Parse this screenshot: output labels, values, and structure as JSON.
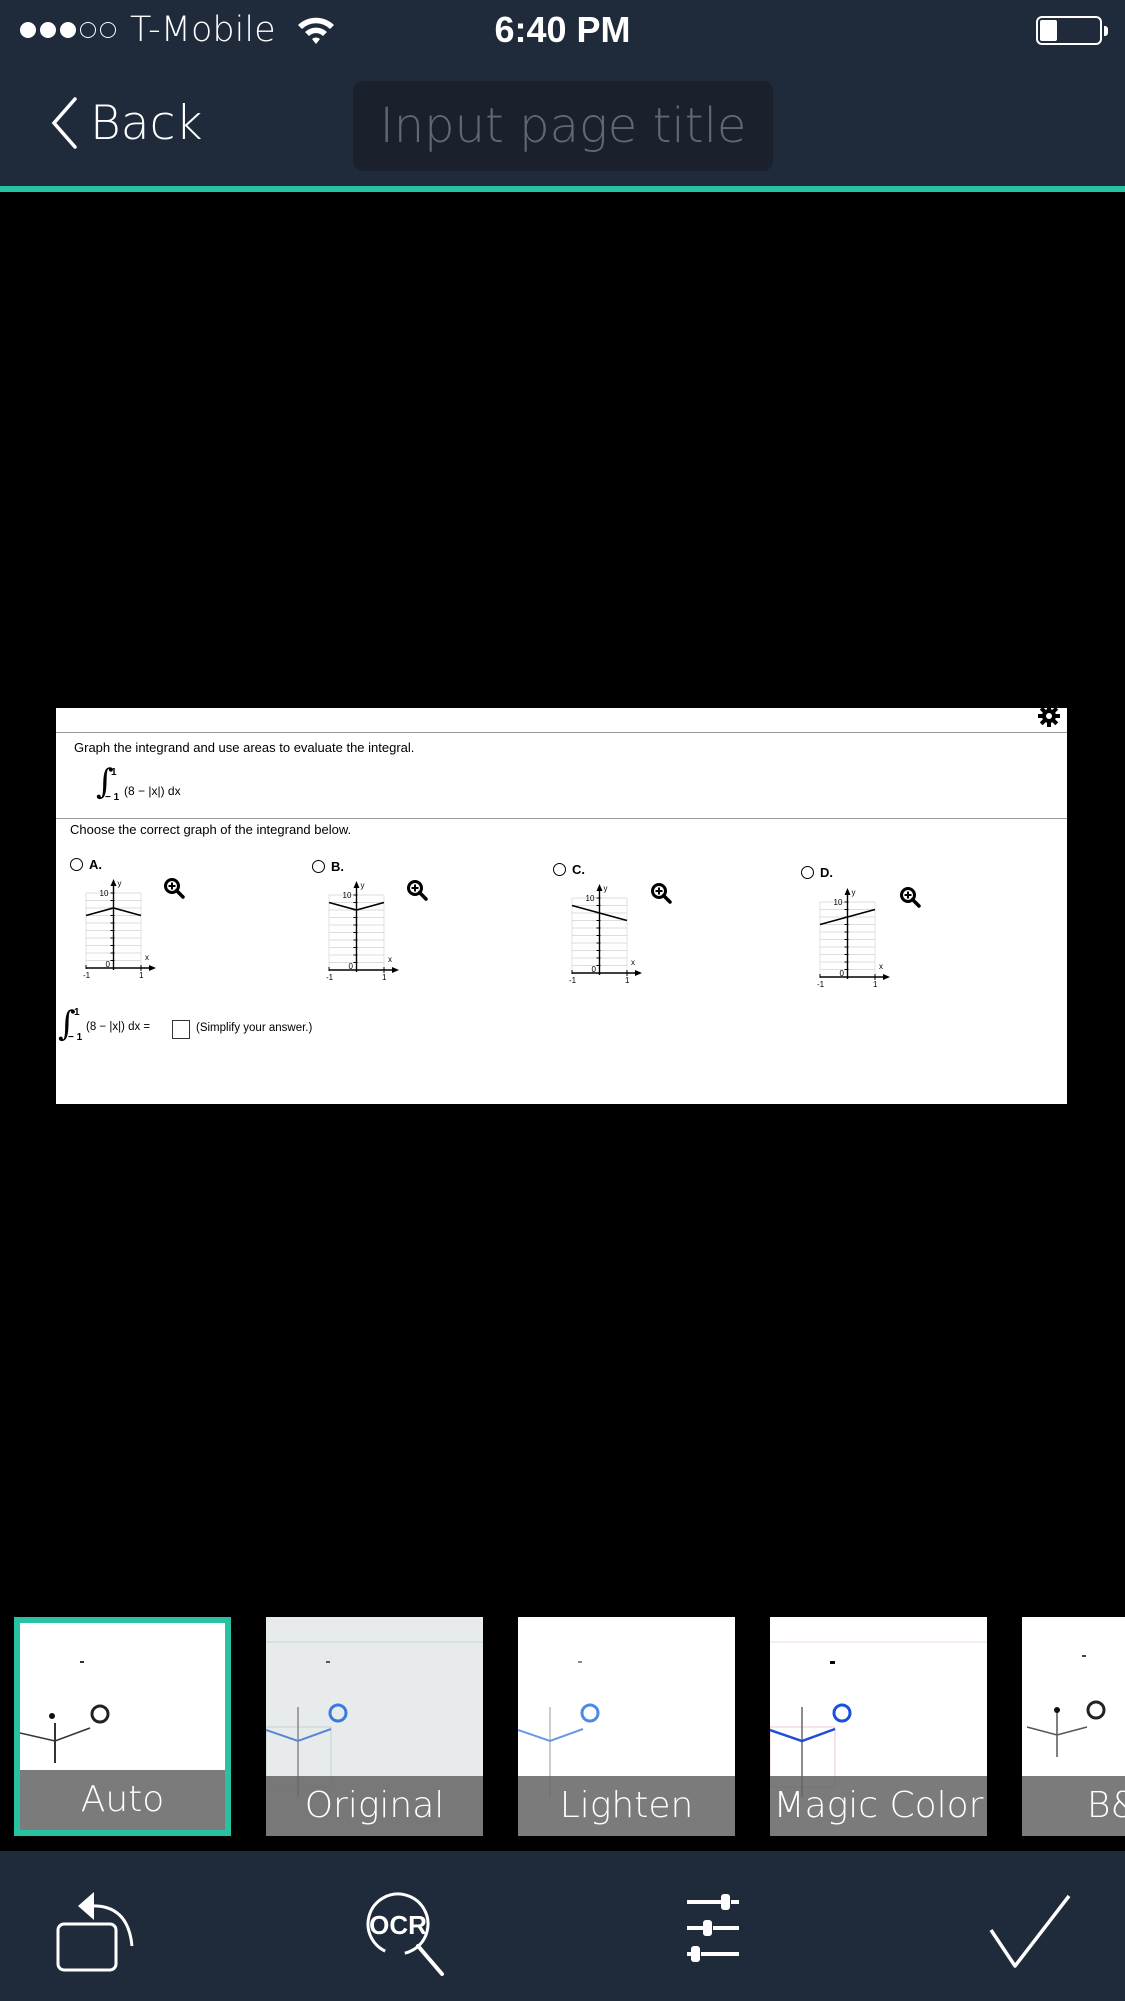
{
  "status_bar": {
    "signal_bars_filled": 3,
    "signal_bars_total": 5,
    "carrier": "T-Mobile",
    "time": "6:40 PM",
    "battery_level": 0.3
  },
  "nav": {
    "back_label": "Back",
    "title_placeholder": "Input page title",
    "title_value": ""
  },
  "colors": {
    "bar_background": "#1f2a3b",
    "accent": "#26c2a2",
    "title_field": "#1a212c",
    "placeholder": "#5e6877"
  },
  "document": {
    "instruction": "Graph the integrand and use areas to evaluate the integral.",
    "integral": {
      "upper": "1",
      "lower": "− 1",
      "integrand": "(8 − |x|) dx"
    },
    "prompt": "Choose the correct graph of the integrand below.",
    "options": [
      {
        "label": "A.",
        "points": [
          [
            -1,
            7
          ],
          [
            0,
            8
          ],
          [
            1,
            7
          ]
        ]
      },
      {
        "label": "B.",
        "points": [
          [
            -1,
            9
          ],
          [
            0,
            8
          ],
          [
            1,
            9
          ]
        ]
      },
      {
        "label": "C.",
        "points": [
          [
            -1,
            9
          ],
          [
            1,
            7
          ]
        ]
      },
      {
        "label": "D.",
        "points": [
          [
            -1,
            7
          ],
          [
            1,
            9
          ]
        ]
      }
    ],
    "graph_axes": {
      "y_label": "y",
      "x_label": "x",
      "y_tick_top": "10",
      "origin": "0",
      "x_min": "-1",
      "x_max": "1",
      "ylim": [
        0,
        10
      ],
      "xlim": [
        -1,
        1
      ]
    },
    "answer": {
      "integrand": "(8 − |x|) dx =",
      "value": "",
      "hint": "(Simplify your answer.)"
    }
  },
  "filters": [
    {
      "label": "Auto",
      "selected": true
    },
    {
      "label": "Original",
      "selected": false
    },
    {
      "label": "Lighten",
      "selected": false
    },
    {
      "label": "Magic Color",
      "selected": false
    },
    {
      "label": "B&W",
      "selected": false
    }
  ],
  "toolbar": {
    "rotate": "rotate-icon",
    "ocr": "ocr-icon",
    "ocr_text": "OCR",
    "adjust": "adjust-sliders-icon",
    "confirm": "checkmark-icon"
  }
}
